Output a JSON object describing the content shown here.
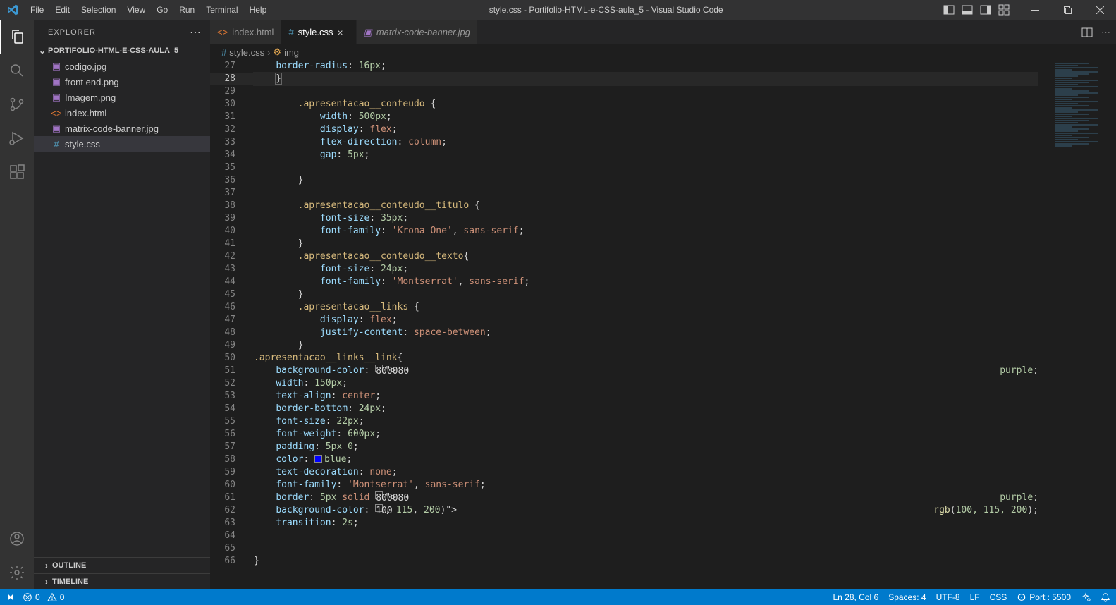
{
  "title": "style.css - Portifolio-HTML-e-CSS-aula_5 - Visual Studio Code",
  "menu": [
    "File",
    "Edit",
    "Selection",
    "View",
    "Go",
    "Run",
    "Terminal",
    "Help"
  ],
  "sidebar": {
    "title": "EXPLORER",
    "project": "PORTIFOLIO-HTML-E-CSS-AULA_5",
    "files": [
      {
        "name": "codigo.jpg",
        "icon": "image",
        "active": false
      },
      {
        "name": "front end.png",
        "icon": "image",
        "active": false
      },
      {
        "name": "Imagem.png",
        "icon": "image",
        "active": false
      },
      {
        "name": "index.html",
        "icon": "html",
        "active": false
      },
      {
        "name": "matrix-code-banner.jpg",
        "icon": "image",
        "active": false
      },
      {
        "name": "style.css",
        "icon": "css",
        "active": true
      }
    ],
    "outline": "OUTLINE",
    "timeline": "TIMELINE"
  },
  "tabs": [
    {
      "name": "index.html",
      "icon": "html",
      "active": false,
      "italic": false,
      "close": false
    },
    {
      "name": "style.css",
      "icon": "css",
      "active": true,
      "italic": false,
      "close": true
    },
    {
      "name": "matrix-code-banner.jpg",
      "icon": "image",
      "active": false,
      "italic": true,
      "close": false
    }
  ],
  "breadcrumb": {
    "file": "style.css",
    "symbol": "img"
  },
  "code": {
    "start": 27,
    "lines": [
      "    border-radius: 16px;",
      "    }",
      "",
      "        .apresentacao__conteudo {",
      "            width: 500px;",
      "            display: flex;",
      "            flex-direction: column;",
      "            gap: 5px;",
      "",
      "        }",
      "",
      "        .apresentacao__conteudo__titulo {",
      "            font-size: 35px;",
      "            font-family: 'Krona One', sans-serif;",
      "        }",
      "        .apresentacao__conteudo__texto{",
      "            font-size: 24px;",
      "            font-family: 'Montserrat', sans-serif;",
      "        }",
      "        .apresentacao__links {",
      "            display: flex;",
      "            justify-content: space-between;",
      "        }",
      ".apresentacao__links__link{",
      "    background-color: @purple;",
      "    width: 150px;",
      "    text-align: center;",
      "    border-bottom: 24px;",
      "    font-size: 22px;",
      "    font-weight: 600px;",
      "    padding: 5px 0;",
      "    color: @blue;",
      "    text-decoration: none;",
      "    font-family: 'Montserrat', sans-serif;",
      "    border: 5px solid @purple;",
      "    background-color: @rgb(100, 115, 200);",
      "    transition: 2s;",
      "",
      "",
      "}"
    ],
    "currentRel": 1
  },
  "status": {
    "errors": "0",
    "warnings": "0",
    "port_label": "Port : 5500",
    "cursor": "Ln 28, Col 6",
    "spaces": "Spaces: 4",
    "encoding": "UTF-8",
    "eol": "LF",
    "lang": "CSS"
  }
}
